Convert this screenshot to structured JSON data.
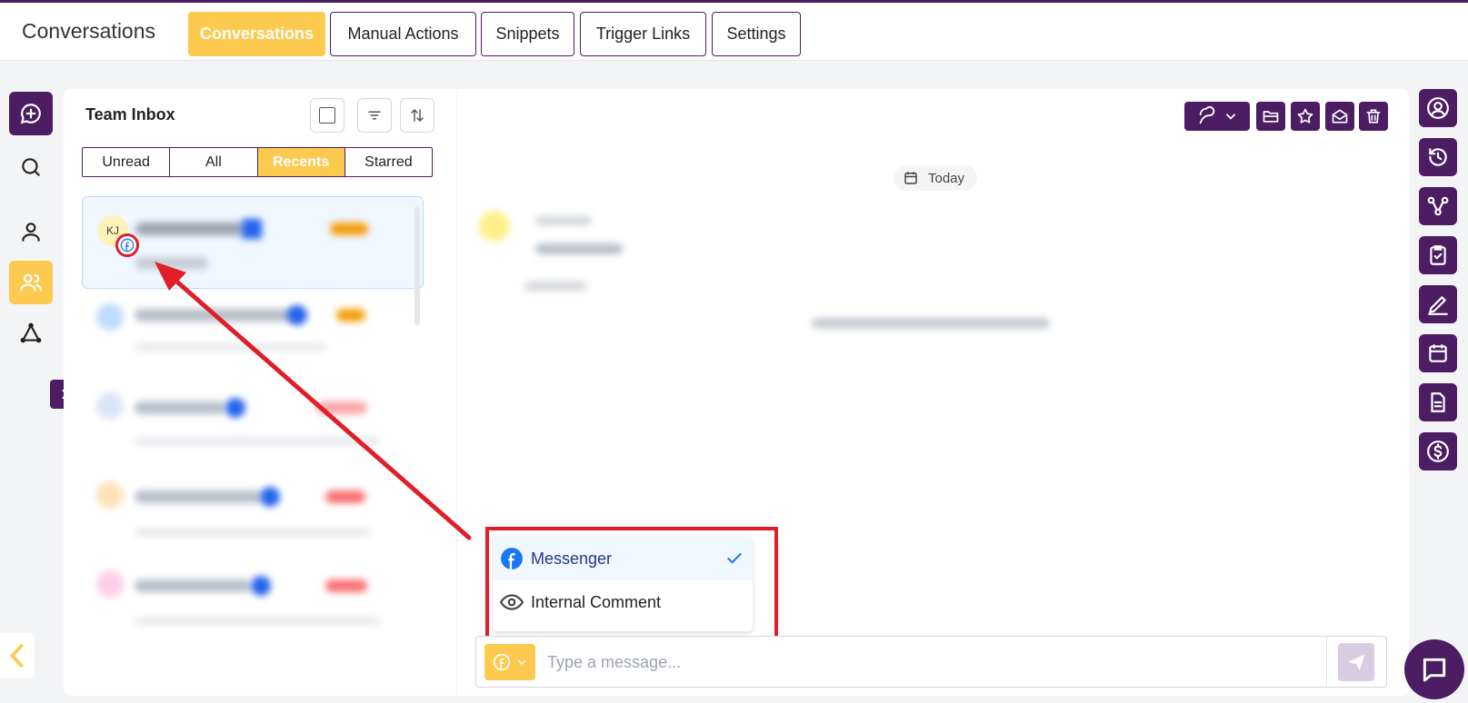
{
  "header": {
    "app_title": "Conversations",
    "tabs": [
      {
        "label": "Conversations",
        "active": true
      },
      {
        "label": "Manual Actions",
        "active": false
      },
      {
        "label": "Snippets",
        "active": false
      },
      {
        "label": "Trigger Links",
        "active": false
      },
      {
        "label": "Settings",
        "active": false
      }
    ]
  },
  "inbox": {
    "title": "Team Inbox",
    "filters": [
      {
        "label": "Unread",
        "active": false
      },
      {
        "label": "All",
        "active": false
      },
      {
        "label": "Recents",
        "active": true
      },
      {
        "label": "Starred",
        "active": false
      }
    ],
    "selected_avatar_initials": "KJ"
  },
  "chat": {
    "date_chip": "Today",
    "channel_options": [
      {
        "label": "Messenger",
        "icon": "facebook-icon",
        "selected": true
      },
      {
        "label": "Internal Comment",
        "icon": "eye-icon",
        "selected": false
      }
    ],
    "message_placeholder": "Type a message..."
  },
  "colors": {
    "brand_purple": "#4c1d62",
    "accent_yellow": "#fdc94e",
    "highlight_red": "#e11d2a",
    "facebook_blue": "#1877f2"
  }
}
